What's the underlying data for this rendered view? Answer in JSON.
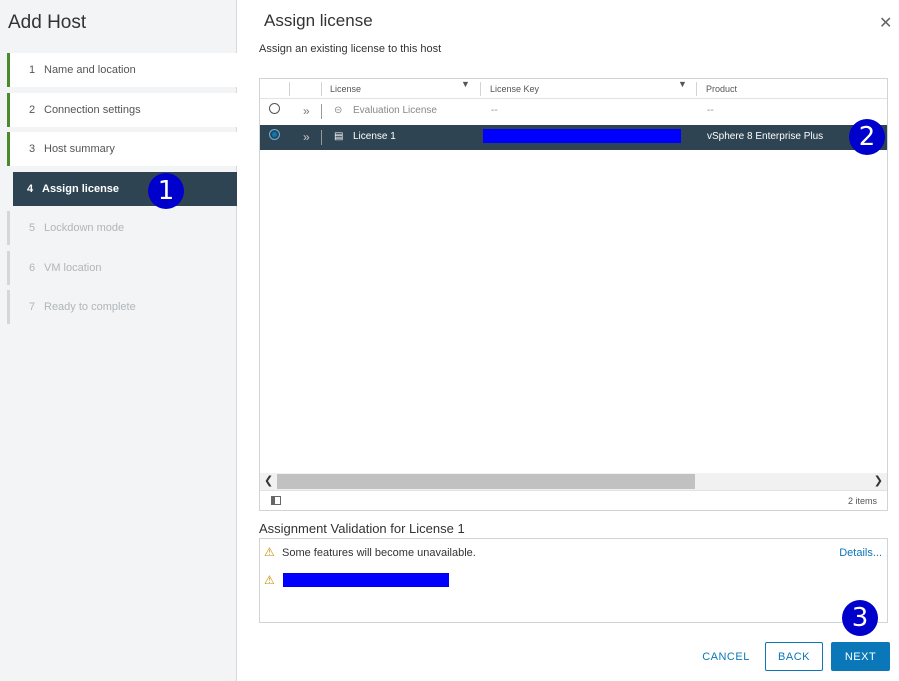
{
  "sidebar": {
    "title": "Add Host",
    "steps": [
      {
        "num": "1",
        "label": "Name and location"
      },
      {
        "num": "2",
        "label": "Connection settings"
      },
      {
        "num": "3",
        "label": "Host summary"
      },
      {
        "num": "4",
        "label": "Assign license"
      },
      {
        "num": "5",
        "label": "Lockdown mode"
      },
      {
        "num": "6",
        "label": "VM location"
      },
      {
        "num": "7",
        "label": "Ready to complete"
      }
    ],
    "current_step": 4
  },
  "main": {
    "title": "Assign license",
    "subtitle": "Assign an existing license to this host",
    "close_icon": "close-icon"
  },
  "grid": {
    "columns": [
      "License",
      "License Key",
      "Product"
    ],
    "rows": [
      {
        "license": "Evaluation License",
        "key": "--",
        "product": "--",
        "selected": false
      },
      {
        "license": "License 1",
        "key": "",
        "product": "vSphere 8 Enterprise Plus",
        "selected": true
      }
    ],
    "footer_count": "2 items"
  },
  "validation": {
    "title": "Assignment Validation for License 1",
    "warning_1": "Some features will become unavailable.",
    "details_link": "Details..."
  },
  "buttons": {
    "cancel": "CANCEL",
    "back": "BACK",
    "next": "NEXT"
  },
  "callouts": [
    "1",
    "2",
    "3"
  ],
  "colors": {
    "accent": "#0a78b8",
    "selected_row": "#2e4452",
    "callout": "#0000cc",
    "redaction": "#0000ff",
    "done_step_bar": "#4a8a2d"
  }
}
